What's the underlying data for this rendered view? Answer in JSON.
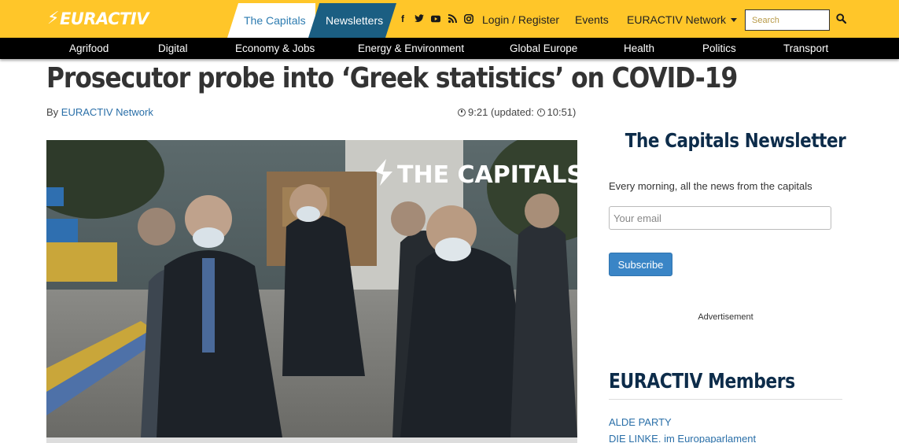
{
  "header": {
    "logo_text": "EURACTIV",
    "tabs": [
      {
        "label": "The Capitals"
      },
      {
        "label": "Newsletters"
      }
    ],
    "social_icons": [
      "facebook-icon",
      "twitter-icon",
      "youtube-icon",
      "rss-icon",
      "instagram-icon"
    ],
    "social_glyphs": [
      "f",
      "t",
      "▶",
      "◉",
      "◎"
    ],
    "nav": {
      "login": "Login / Register",
      "events": "Events",
      "network": "EURACTIV Network"
    },
    "search_placeholder": "Search",
    "colors": {
      "bar": "#ffc629",
      "newsletters_tab": "#1b5e82",
      "capitals_tab_text": "#2c7bb0"
    }
  },
  "categories": [
    "Agrifood",
    "Digital",
    "Economy & Jobs",
    "Energy & Environment",
    "Global Europe",
    "Health",
    "Politics",
    "Transport"
  ],
  "article": {
    "headline": "Prosecutor probe into ‘Greek statistics’ on COVID-19",
    "byline_prefix": "By",
    "author": "EURACTIV Network",
    "time": "9:21",
    "updated_label": "(updated:",
    "updated_time": "10:51)",
    "image_watermark": "THE CAPITALS"
  },
  "sidebar": {
    "newsletter_title": "The Capitals Newsletter",
    "newsletter_desc": "Every morning, all the news from the capitals",
    "email_placeholder": "Your email",
    "subscribe_label": "Subscribe",
    "ad_label": "Advertisement",
    "members_title": "EURACTIV Members",
    "members": [
      "ALDE PARTY",
      "DIE LINKE. im Europaparlament"
    ]
  }
}
